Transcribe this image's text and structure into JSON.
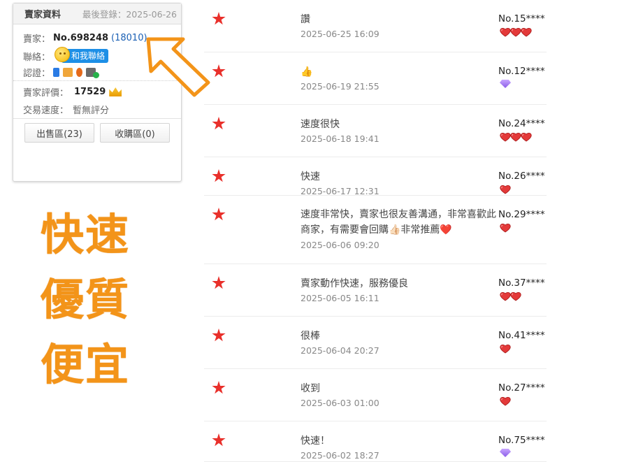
{
  "seller_card": {
    "title": "賣家資料",
    "last_login": "最後登錄：2025-06-26",
    "seller_label": "賣家：",
    "seller_id": "No.698248",
    "seller_count": "(18010)",
    "contact_label": "聯絡：",
    "contact_button": "和我聯絡",
    "cert_label": "認證：",
    "rating_label": "賣家評價：",
    "rating_value": "17529",
    "speed_label": "交易速度：",
    "speed_value": "暫無評分",
    "sell_tab": "出售區(23)",
    "buy_tab": "收購區(0)"
  },
  "promo": {
    "line1": "快速",
    "line2": "優質",
    "line3": "便宜"
  },
  "colors": {
    "accent_orange": "#f39419",
    "star_red": "#e9302b",
    "link_blue": "#1a5fb4"
  },
  "reviews": [
    {
      "text": "讚",
      "date": "2025-06-25 16:09",
      "user": "No.15****",
      "badge": "heart",
      "badge_count": 3
    },
    {
      "text": "👍",
      "date": "2025-06-19 21:55",
      "user": "No.12****",
      "badge": "diamond",
      "badge_count": 1
    },
    {
      "text": "速度很快",
      "date": "2025-06-18 19:41",
      "user": "No.24****",
      "badge": "heart",
      "badge_count": 3
    },
    {
      "text": "快速",
      "date": "2025-06-17 12:31",
      "user": "No.26****",
      "badge": "heart",
      "badge_count": 1
    },
    {
      "text": "速度非常快，賣家也很友善溝通，非常喜歡此商家，有需要會回購👍🏻非常推薦❤️",
      "date": "2025-06-06 09:20",
      "user": "No.29****",
      "badge": "heart",
      "badge_count": 1
    },
    {
      "text": "賣家動作快速，服務優良",
      "date": "2025-06-05 16:11",
      "user": "No.37****",
      "badge": "heart",
      "badge_count": 2
    },
    {
      "text": "很棒",
      "date": "2025-06-04 20:27",
      "user": "No.41****",
      "badge": "heart",
      "badge_count": 1
    },
    {
      "text": "收到",
      "date": "2025-06-03 01:00",
      "user": "No.27****",
      "badge": "heart",
      "badge_count": 1
    },
    {
      "text": "快速！",
      "date": "2025-06-02 18:27",
      "user": "No.75****",
      "badge": "diamond",
      "badge_count": 1
    }
  ]
}
